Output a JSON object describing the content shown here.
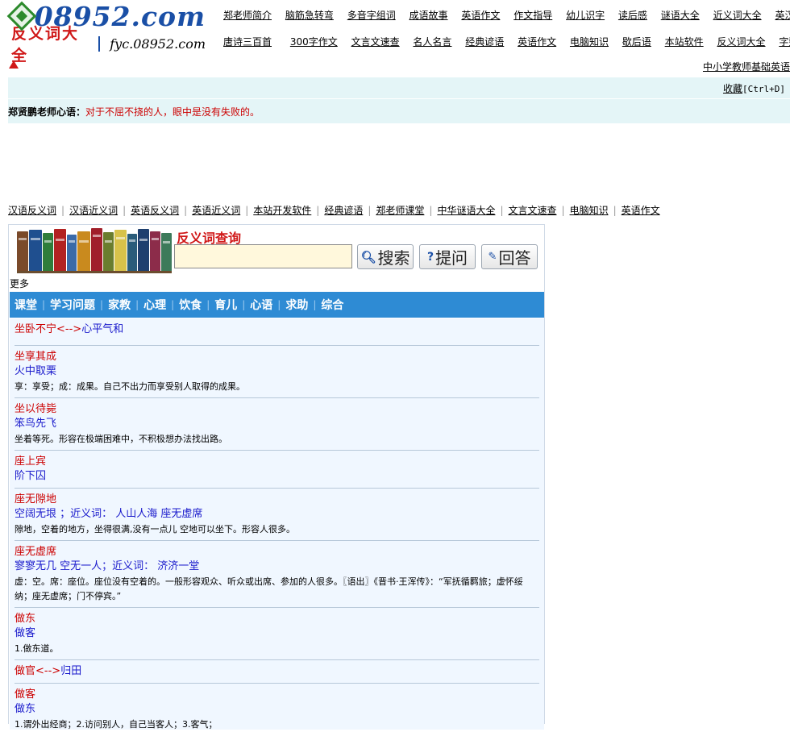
{
  "logo": {
    "domain": "08952.com",
    "cn_title": "反义词大全",
    "subdomain": "fyc.08952.com"
  },
  "topnav_row1": [
    "郑老师简介",
    "脑筋急转弯",
    "多音字组词",
    "成语故事",
    "英语作文",
    "作文指导",
    "幼儿识字",
    "读后感",
    "谜语大全",
    "近义词大全",
    "英汉互译"
  ],
  "topnav_row2": [
    "唐诗三百首",
    "300字作文",
    "文言文速查",
    "名人名言",
    "经典谚语",
    "英语作文",
    "电脑知识",
    "歇后语",
    "本站软件",
    "反义词大全",
    "字数作文"
  ],
  "right_link": "中小学教师基础英语",
  "favorite": {
    "label": "收藏",
    "shortcut": "[Ctrl+D]"
  },
  "motto": {
    "label": "郑贤鹏老师心语：",
    "text": "对于不屈不挠的人，眼中是没有失败的。"
  },
  "midnav": [
    "汉语反义词",
    "汉语近义词",
    "英语反义词",
    "英语近义词",
    "本站开发软件",
    "经典谚语",
    "郑老师课堂",
    "中华谜语大全",
    "文言文速查",
    "电脑知识",
    "英语作文"
  ],
  "search": {
    "title": "反义词查询",
    "input_value": "",
    "btn_search": "搜索",
    "btn_ask": "提问",
    "btn_answer": "回答"
  },
  "more_label": "更多",
  "categories": [
    "课堂",
    "学习问题",
    "家教",
    "心理",
    "饮食",
    "育儿",
    "心语",
    "求助",
    "综合"
  ],
  "entries": [
    {
      "word": "坐卧不宁",
      "arrow": "<-->",
      "antonym": "心平气和"
    },
    {
      "word": "坐享其成",
      "antonym": "火中取栗",
      "explain": "享：享受；成：成果。自己不出力而享受别人取得的成果。"
    },
    {
      "word": "坐以待毙",
      "antonym": "笨鸟先飞",
      "explain": "坐着等死。形容在极端困难中，不积极想办法找出路。"
    },
    {
      "word": "座上宾",
      "antonym": "阶下囚"
    },
    {
      "word": "座无隙地",
      "antonym": "空阔无垠 ；近义词：  人山人海 座无虚席",
      "explain": "隙地，空着的地方，坐得很满,没有一点儿 空地可以坐下。形容人很多。"
    },
    {
      "word": "座无虚席",
      "antonym": "寥寥无几 空无一人；近义词：  济济一堂",
      "explain": "虚：空。席：座位。座位没有空着的。一般形容观众、听众或出席、参加的人很多。〖语出〗《晋书·王浑传》：“军抚循羁旅；虚怀绥纳；座无虚席；门不停宾。”"
    },
    {
      "word": "做东",
      "antonym": "做客",
      "explain": "1.做东道。"
    },
    {
      "word": "做官",
      "arrow": "<-->",
      "antonym": "归田"
    },
    {
      "word": "做客",
      "antonym": "做东",
      "explain": "1.谓外出经商；2.访问别人，自己当客人；3.客气；"
    }
  ],
  "colors": {
    "accent_blue": "#2e8bd4",
    "link_red": "#cc0000",
    "antonym_blue": "#1a1acc",
    "band_bg": "#e4f5f7",
    "list_bg": "#f0f7ff",
    "input_bg": "#fff8dc"
  },
  "icons": {
    "logo": "diamond-logo-icon",
    "arrow": "arrow-up-icon",
    "search": "magnifier-icon",
    "ask": "question-icon",
    "answer": "pencil-icon"
  }
}
